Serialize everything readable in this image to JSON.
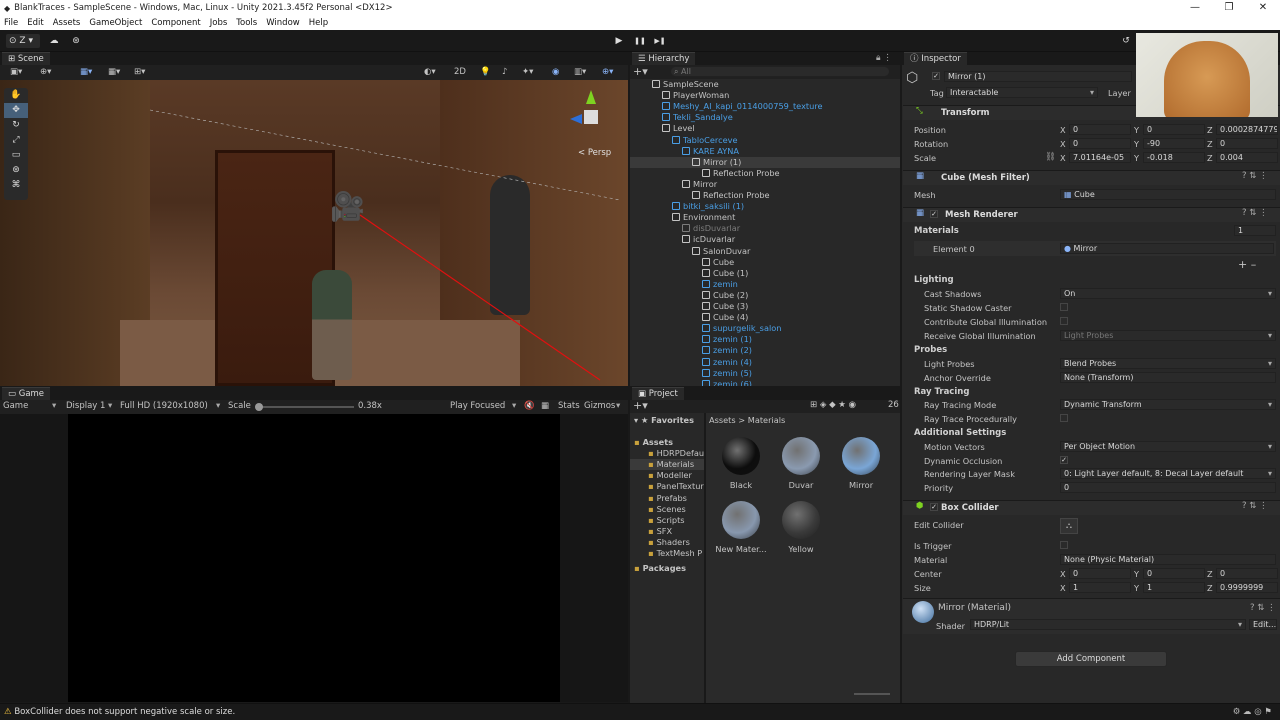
{
  "window": {
    "title": "BlankTraces - SampleScene - Windows, Mac, Linux - Unity 2021.3.45f2 Personal <DX12>",
    "min": "—",
    "max": "❐",
    "close": "✕"
  },
  "menu": [
    "File",
    "Edit",
    "Assets",
    "GameObject",
    "Component",
    "Jobs",
    "Tools",
    "Window",
    "Help"
  ],
  "toolbar": {
    "account": "Z",
    "play": "▶",
    "pause": "❚❚",
    "step": "▶❚"
  },
  "scene": {
    "tab": "Scene",
    "persp": "< Persp",
    "mode2d": "2D"
  },
  "game": {
    "tab": "Game",
    "display_mode": "Game",
    "display": "Display 1",
    "resolution": "Full HD (1920x1080)",
    "scale_label": "Scale",
    "scale_value": "0.38x",
    "play_focused": "Play Focused",
    "stats": "Stats",
    "gizmos": "Gizmos"
  },
  "hierarchy": {
    "tab": "Hierarchy",
    "search_placeholder": "All",
    "rows": [
      {
        "t": "SampleScene",
        "d": 0,
        "c": "w"
      },
      {
        "t": "PlayerWoman",
        "d": 1,
        "c": "w"
      },
      {
        "t": "Meshy_AI_kapi_0114000759_texture",
        "d": 1,
        "c": "b"
      },
      {
        "t": "Tekli_Sandalye",
        "d": 1,
        "c": "b"
      },
      {
        "t": "Level",
        "d": 1,
        "c": "w"
      },
      {
        "t": "TabloCerceve",
        "d": 2,
        "c": "b"
      },
      {
        "t": "KARE AYNA",
        "d": 3,
        "c": "b"
      },
      {
        "t": "Mirror (1)",
        "d": 4,
        "c": "w",
        "sel": true
      },
      {
        "t": "Reflection Probe",
        "d": 5,
        "c": "w"
      },
      {
        "t": "Mirror",
        "d": 3,
        "c": "w"
      },
      {
        "t": "Reflection Probe",
        "d": 4,
        "c": "w"
      },
      {
        "t": "bitki_saksili (1)",
        "d": 2,
        "c": "b"
      },
      {
        "t": "Environment",
        "d": 2,
        "c": "w"
      },
      {
        "t": "disDuvarlar",
        "d": 3,
        "c": "g"
      },
      {
        "t": "icDuvarlar",
        "d": 3,
        "c": "w"
      },
      {
        "t": "SalonDuvar",
        "d": 4,
        "c": "w"
      },
      {
        "t": "Cube",
        "d": 5,
        "c": "w"
      },
      {
        "t": "Cube (1)",
        "d": 5,
        "c": "w"
      },
      {
        "t": "zemin",
        "d": 5,
        "c": "b"
      },
      {
        "t": "Cube (2)",
        "d": 5,
        "c": "w"
      },
      {
        "t": "Cube (3)",
        "d": 5,
        "c": "w"
      },
      {
        "t": "Cube (4)",
        "d": 5,
        "c": "w"
      },
      {
        "t": "supurgelik_salon",
        "d": 5,
        "c": "b"
      },
      {
        "t": "zemin (1)",
        "d": 5,
        "c": "b"
      },
      {
        "t": "zemin (2)",
        "d": 5,
        "c": "b"
      },
      {
        "t": "zemin (4)",
        "d": 5,
        "c": "b"
      },
      {
        "t": "zemin (5)",
        "d": 5,
        "c": "b"
      },
      {
        "t": "zemin (6)",
        "d": 5,
        "c": "b"
      }
    ]
  },
  "project": {
    "tab": "Project",
    "count": "26",
    "favorites": "Favorites",
    "tree": [
      {
        "t": "Assets",
        "d": 0,
        "bold": true
      },
      {
        "t": "HDRPDefau",
        "d": 1
      },
      {
        "t": "Materials",
        "d": 1,
        "sel": true
      },
      {
        "t": "Modeller",
        "d": 1
      },
      {
        "t": "PanelTextur",
        "d": 1
      },
      {
        "t": "Prefabs",
        "d": 1
      },
      {
        "t": "Scenes",
        "d": 1
      },
      {
        "t": "Scripts",
        "d": 1
      },
      {
        "t": "SFX",
        "d": 1
      },
      {
        "t": "Shaders",
        "d": 1
      },
      {
        "t": "TextMesh P",
        "d": 1
      },
      {
        "t": "Packages",
        "d": 0,
        "bold": true
      }
    ],
    "breadcrumb_root": "Assets",
    "breadcrumb_sep": ">",
    "breadcrumb_leaf": "Materials",
    "materials": [
      {
        "name": "Black",
        "color": "#0d0d0d"
      },
      {
        "name": "Duvar",
        "color": "#8a9ab0"
      },
      {
        "name": "Mirror",
        "color": "#7aa6d6"
      },
      {
        "name": "New Mater...",
        "color": "#8898ae"
      },
      {
        "name": "Yellow",
        "color": "#3a3a3a"
      }
    ]
  },
  "inspector": {
    "tab": "Inspector",
    "object_name": "Mirror (1)",
    "tag_label": "Tag",
    "tag_value": "Interactable",
    "layer_label": "Layer",
    "transform": {
      "title": "Transform",
      "position_label": "Position",
      "rotation_label": "Rotation",
      "scale_label": "Scale",
      "position": {
        "x": "0",
        "y": "0",
        "z": "0.0002874779"
      },
      "rotation": {
        "x": "0",
        "y": "-90",
        "z": "0"
      },
      "scale": {
        "x": "7.01164e-05",
        "y": "-0.018",
        "z": "0.004"
      }
    },
    "mesh_filter": {
      "title": "Cube (Mesh Filter)",
      "mesh_label": "Mesh",
      "mesh_value": "Cube"
    },
    "mesh_renderer": {
      "title": "Mesh Renderer",
      "materials_label": "Materials",
      "materials_count": "1",
      "element_label": "Element 0",
      "element_value": "Mirror",
      "lighting_label": "Lighting",
      "cast_shadows_label": "Cast Shadows",
      "cast_shadows": "On",
      "static_shadow_label": "Static Shadow Caster",
      "contribute_gi_label": "Contribute Global Illumination",
      "receive_gi_label": "Receive Global Illumination",
      "receive_gi": "Light Probes",
      "probes_label": "Probes",
      "light_probes_label": "Light Probes",
      "light_probes": "Blend Probes",
      "anchor_label": "Anchor Override",
      "anchor": "None (Transform)",
      "ray_label": "Ray Tracing",
      "ray_mode_label": "Ray Tracing Mode",
      "ray_mode": "Dynamic Transform",
      "ray_proc_label": "Ray Trace Procedurally",
      "additional_label": "Additional Settings",
      "motion_label": "Motion Vectors",
      "motion": "Per Object Motion",
      "dyn_occ_label": "Dynamic Occlusion",
      "rlm_label": "Rendering Layer Mask",
      "rlm": "0: Light Layer default, 8: Decal Layer default",
      "priority_label": "Priority",
      "priority": "0"
    },
    "box_collider": {
      "title": "Box Collider",
      "edit_label": "Edit Collider",
      "trigger_label": "Is Trigger",
      "material_label": "Material",
      "material": "None (Physic Material)",
      "center_label": "Center",
      "size_label": "Size",
      "center": {
        "x": "0",
        "y": "0",
        "z": "0"
      },
      "size": {
        "x": "1",
        "y": "1",
        "z": "0.9999999"
      }
    },
    "material": {
      "title": "Mirror (Material)",
      "shader_label": "Shader",
      "shader": "HDRP/Lit",
      "edit": "Edit..."
    },
    "add_component": "Add Component"
  },
  "status": "BoxCollider does not support negative scale or size."
}
